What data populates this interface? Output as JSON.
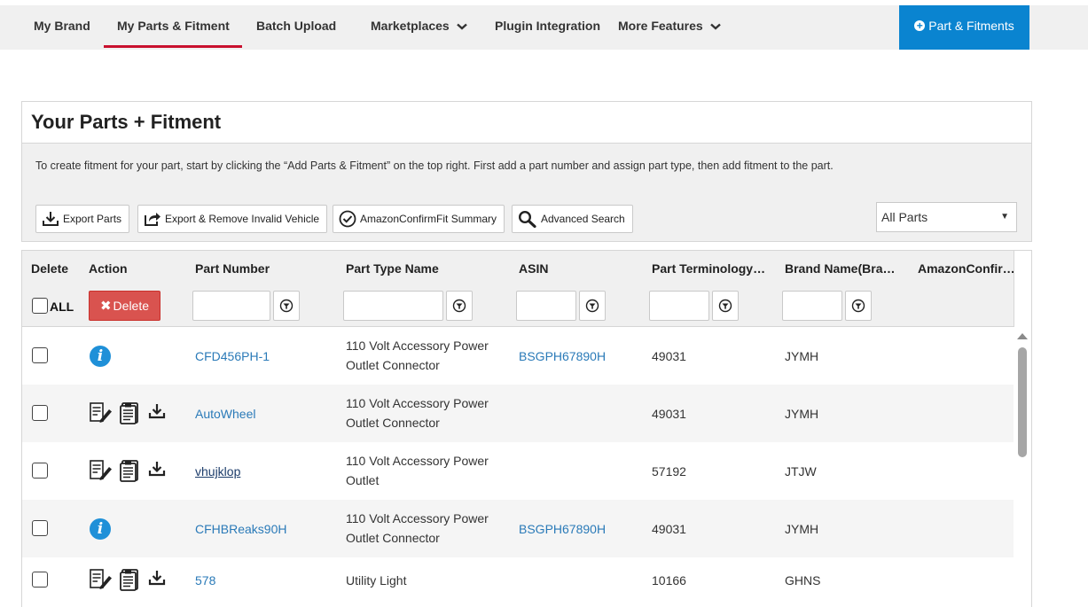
{
  "nav": {
    "items": [
      {
        "label": "My Brand"
      },
      {
        "label": "My Parts & Fitment"
      },
      {
        "label": "Batch Upload"
      },
      {
        "label": "Marketplaces"
      },
      {
        "label": "Plugin Integration"
      },
      {
        "label": "More Features"
      }
    ],
    "cta_label": "Part & Fitments"
  },
  "panel": {
    "title": "Your Parts + Fitment",
    "description": "To create fitment for your part, start by clicking the “Add Parts & Fitment” on the top right. First add a part number and assign part type, then add fitment to the part.",
    "buttons": {
      "export": "Export Parts",
      "export_remove": "Export & Remove Invalid Vehicle",
      "amazon_summary": "AmazonConfirmFit Summary",
      "advanced_search": "Advanced Search"
    },
    "filter_select": "All Parts"
  },
  "grid": {
    "headers": {
      "delete": "Delete",
      "action": "Action",
      "part_number": "Part Number",
      "part_type": "Part Type Name",
      "asin": "ASIN",
      "terminology": "Part Terminology…",
      "brand": "Brand Name(Bra…",
      "amazon": "AmazonConfir…"
    },
    "all_label": "ALL",
    "delete_label": "Delete",
    "rows": [
      {
        "part_number": "CFD456PH-1",
        "part_type_1": "110 Volt Accessory Power",
        "part_type_2": "Outlet Connector",
        "asin": "BSGPH67890H",
        "terminology": "49031",
        "brand": "JYMH",
        "action": "info"
      },
      {
        "part_number": "AutoWheel",
        "part_type_1": "110 Volt Accessory Power",
        "part_type_2": "Outlet Connector",
        "asin": "",
        "terminology": "49031",
        "brand": "JYMH",
        "action": "tools"
      },
      {
        "part_number": "vhujklop",
        "part_type_1": "110 Volt Accessory Power",
        "part_type_2": "Outlet",
        "asin": "",
        "terminology": "57192",
        "brand": "JTJW",
        "action": "tools"
      },
      {
        "part_number": "CFHBReaks90H",
        "part_type_1": "110 Volt Accessory Power",
        "part_type_2": "Outlet Connector",
        "asin": "BSGPH67890H",
        "terminology": "49031",
        "brand": "JYMH",
        "action": "info"
      },
      {
        "part_number": "578",
        "part_type_1": "Utility Light",
        "part_type_2": "",
        "asin": "",
        "terminology": "10166",
        "brand": "GHNS",
        "action": "tools"
      }
    ]
  },
  "colors": {
    "accent_red": "#c8102e",
    "cta_blue": "#0a84d0",
    "delete_red": "#d9534f",
    "link_blue": "#2a7ab8",
    "info_blue": "#1f90d8"
  }
}
